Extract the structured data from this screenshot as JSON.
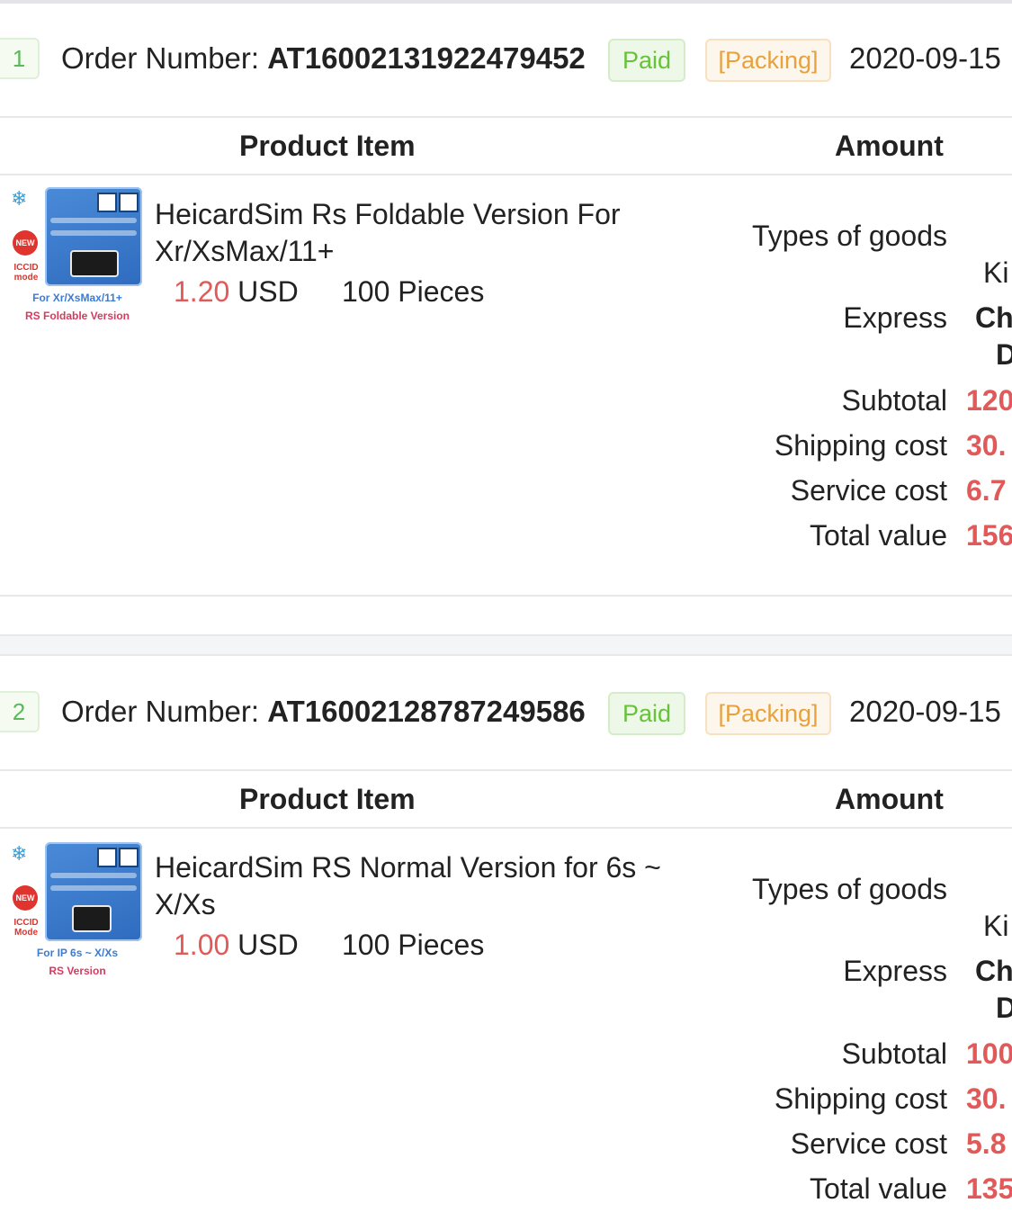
{
  "orders": [
    {
      "index": "1",
      "order_label": "Order Number:",
      "order_number": "AT16002131922479452",
      "payment_status": "Paid",
      "shipping_status": "[Packing]",
      "date": "2020-09-15",
      "header_product": "Product Item",
      "header_amount": "Amount",
      "thumb_caption_1": "For Xr/XsMax/11+",
      "thumb_caption_2": "RS Foldable Version",
      "thumb_badge": "NEW",
      "thumb_mode_1": "ICCID",
      "thumb_mode_2": "mode",
      "product_name": "HeicardSim Rs Foldable Version For Xr/XsMax/11+",
      "price": "1.20",
      "currency": "USD",
      "quantity": "100 Pieces",
      "labels": {
        "types": "Types of goods",
        "express": "Express",
        "subtotal": "Subtotal",
        "shipping": "Shipping cost",
        "service": "Service cost",
        "total": "Total value"
      },
      "values": {
        "types": "Ki",
        "express_1": "Ch",
        "express_2": "D",
        "subtotal": "120",
        "shipping": "30.",
        "service": "6.7",
        "total": "156"
      }
    },
    {
      "index": "2",
      "order_label": "Order Number:",
      "order_number": "AT16002128787249586",
      "payment_status": "Paid",
      "shipping_status": "[Packing]",
      "date": "2020-09-15",
      "header_product": "Product Item",
      "header_amount": "Amount",
      "thumb_caption_1": "For IP 6s ~ X/Xs",
      "thumb_caption_2": "RS Version",
      "thumb_badge": "NEW",
      "thumb_mode_1": "ICCID",
      "thumb_mode_2": "Mode",
      "product_name": "HeicardSim RS Normal Version for 6s ~ X/Xs",
      "price": "1.00",
      "currency": "USD",
      "quantity": "100 Pieces",
      "labels": {
        "types": "Types of goods",
        "express": "Express",
        "subtotal": "Subtotal",
        "shipping": "Shipping cost",
        "service": "Service cost",
        "total": "Total value"
      },
      "values": {
        "types": "Ki",
        "express_1": "Ch",
        "express_2": "D",
        "subtotal": "100",
        "shipping": "30.",
        "service": "5.8",
        "total": "135"
      }
    }
  ],
  "colors": {
    "accent_red": "#e05a5a",
    "paid_green": "#67c23a",
    "packing_orange": "#e6a23c"
  }
}
